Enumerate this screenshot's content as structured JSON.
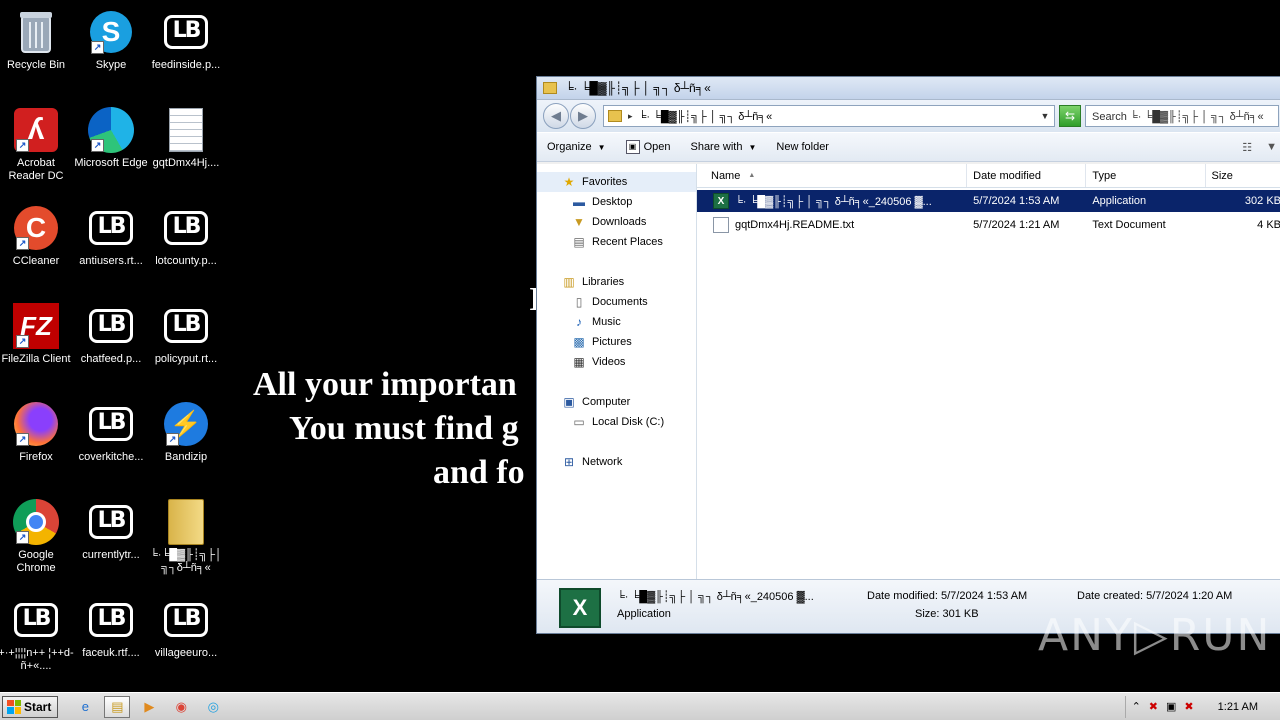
{
  "desktop": {
    "ransom_lines": [
      "I",
      "All your importan",
      "You must find g",
      "and fo"
    ],
    "icons": [
      {
        "label": "Recycle Bin",
        "icon": "recycle-bin-icon"
      },
      {
        "label": "Skype",
        "icon": "skype-icon"
      },
      {
        "label": "feedinside.p...",
        "icon": "lockbit-file-icon"
      },
      {
        "label": "Acrobat Reader DC",
        "icon": "acrobat-icon"
      },
      {
        "label": "Microsoft Edge",
        "icon": "edge-icon"
      },
      {
        "label": "gqtDmx4Hj....",
        "icon": "text-document-icon"
      },
      {
        "label": "CCleaner",
        "icon": "ccleaner-icon"
      },
      {
        "label": "antiusers.rt...",
        "icon": "lockbit-file-icon"
      },
      {
        "label": "lotcounty.p...",
        "icon": "lockbit-file-icon"
      },
      {
        "label": "FileZilla Client",
        "icon": "filezilla-icon"
      },
      {
        "label": "chatfeed.p...",
        "icon": "lockbit-file-icon"
      },
      {
        "label": "policyput.rt...",
        "icon": "lockbit-file-icon"
      },
      {
        "label": "Firefox",
        "icon": "firefox-icon"
      },
      {
        "label": "coverkitche...",
        "icon": "lockbit-file-icon"
      },
      {
        "label": "Bandizip",
        "icon": "bandizip-icon"
      },
      {
        "label": "Google Chrome",
        "icon": "chrome-icon"
      },
      {
        "label": "currentlytr...",
        "icon": "lockbit-file-icon"
      },
      {
        "label": "╘·╘█▓╟┊╗├│╗┐δ┴ñ╕«",
        "icon": "folder-icon"
      },
      {
        "label": "+·+¦¦¦¦n++ ¦++d-ñ+«....",
        "icon": "lockbit-file-icon"
      },
      {
        "label": "faceuk.rtf....",
        "icon": "lockbit-file-icon"
      },
      {
        "label": "villageeuro...",
        "icon": "lockbit-file-icon"
      }
    ],
    "logo_glyph": "LB",
    "watermark": "ANY▷RUN"
  },
  "explorer": {
    "title": "╘· ╘█▓╟┊╗├ │ ╗┐ δ┴ñ╕«",
    "address": "╘· ╘█▓╟┊╗├ │ ╗┐ δ┴ñ╕«",
    "search_placeholder": "Search ╘· ╘█▓╟┊╗├ │ ╗┐ δ┴ñ╕«",
    "toolbar": {
      "organize": "Organize",
      "open": "Open",
      "share_with": "Share with",
      "new_folder": "New folder"
    },
    "nav": {
      "favorites": "Favorites",
      "desktop": "Desktop",
      "downloads": "Downloads",
      "recent_places": "Recent Places",
      "libraries": "Libraries",
      "documents": "Documents",
      "music": "Music",
      "pictures": "Pictures",
      "videos": "Videos",
      "computer": "Computer",
      "local_disk": "Local Disk (C:)",
      "network": "Network"
    },
    "columns": {
      "name": "Name",
      "date_modified": "Date modified",
      "type": "Type",
      "size": "Size"
    },
    "files": [
      {
        "name": "╘· ╘█▓╟┊╗├ │ ╗┐ δ┴ñ╕«_240506 ▓...",
        "date": "5/7/2024 1:53 AM",
        "type": "Application",
        "size": "302 KB",
        "icon": "excel-icon",
        "selected": true
      },
      {
        "name": "gqtDmx4Hj.README.txt",
        "date": "5/7/2024 1:21 AM",
        "type": "Text Document",
        "size": "4 KB",
        "icon": "text-file-icon",
        "selected": false
      }
    ],
    "details": {
      "name": "╘· ╘█▓╟┊╗├ │ ╗┐ δ┴ñ╕«_240506 ▓...",
      "type": "Application",
      "date_modified": "Date modified: 5/7/2024 1:53 AM",
      "size": "Size: 301 KB",
      "date_created": "Date created: 5/7/2024 1:20 AM"
    }
  },
  "taskbar": {
    "start": "Start",
    "clock": "1:21 AM"
  }
}
